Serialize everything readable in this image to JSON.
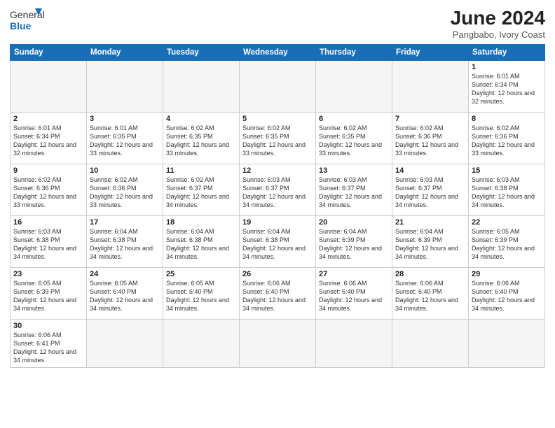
{
  "logo": {
    "text_general": "General",
    "text_blue": "Blue"
  },
  "header": {
    "month": "June 2024",
    "location": "Pangbabo, Ivory Coast"
  },
  "weekdays": [
    "Sunday",
    "Monday",
    "Tuesday",
    "Wednesday",
    "Thursday",
    "Friday",
    "Saturday"
  ],
  "weeks": [
    [
      {
        "day": "",
        "info": "",
        "empty": true
      },
      {
        "day": "",
        "info": "",
        "empty": true
      },
      {
        "day": "",
        "info": "",
        "empty": true
      },
      {
        "day": "",
        "info": "",
        "empty": true
      },
      {
        "day": "",
        "info": "",
        "empty": true
      },
      {
        "day": "",
        "info": "",
        "empty": true
      },
      {
        "day": "1",
        "info": "Sunrise: 6:01 AM\nSunset: 6:34 PM\nDaylight: 12 hours and 32 minutes.",
        "empty": false
      }
    ],
    [
      {
        "day": "2",
        "info": "Sunrise: 6:01 AM\nSunset: 6:34 PM\nDaylight: 12 hours and 32 minutes.",
        "empty": false
      },
      {
        "day": "3",
        "info": "Sunrise: 6:01 AM\nSunset: 6:35 PM\nDaylight: 12 hours and 33 minutes.",
        "empty": false
      },
      {
        "day": "4",
        "info": "Sunrise: 6:02 AM\nSunset: 6:35 PM\nDaylight: 12 hours and 33 minutes.",
        "empty": false
      },
      {
        "day": "5",
        "info": "Sunrise: 6:02 AM\nSunset: 6:35 PM\nDaylight: 12 hours and 33 minutes.",
        "empty": false
      },
      {
        "day": "6",
        "info": "Sunrise: 6:02 AM\nSunset: 6:35 PM\nDaylight: 12 hours and 33 minutes.",
        "empty": false
      },
      {
        "day": "7",
        "info": "Sunrise: 6:02 AM\nSunset: 6:36 PM\nDaylight: 12 hours and 33 minutes.",
        "empty": false
      },
      {
        "day": "8",
        "info": "Sunrise: 6:02 AM\nSunset: 6:36 PM\nDaylight: 12 hours and 33 minutes.",
        "empty": false
      }
    ],
    [
      {
        "day": "9",
        "info": "Sunrise: 6:02 AM\nSunset: 6:36 PM\nDaylight: 12 hours and 33 minutes.",
        "empty": false
      },
      {
        "day": "10",
        "info": "Sunrise: 6:02 AM\nSunset: 6:36 PM\nDaylight: 12 hours and 33 minutes.",
        "empty": false
      },
      {
        "day": "11",
        "info": "Sunrise: 6:02 AM\nSunset: 6:37 PM\nDaylight: 12 hours and 34 minutes.",
        "empty": false
      },
      {
        "day": "12",
        "info": "Sunrise: 6:03 AM\nSunset: 6:37 PM\nDaylight: 12 hours and 34 minutes.",
        "empty": false
      },
      {
        "day": "13",
        "info": "Sunrise: 6:03 AM\nSunset: 6:37 PM\nDaylight: 12 hours and 34 minutes.",
        "empty": false
      },
      {
        "day": "14",
        "info": "Sunrise: 6:03 AM\nSunset: 6:37 PM\nDaylight: 12 hours and 34 minutes.",
        "empty": false
      },
      {
        "day": "15",
        "info": "Sunrise: 6:03 AM\nSunset: 6:38 PM\nDaylight: 12 hours and 34 minutes.",
        "empty": false
      }
    ],
    [
      {
        "day": "16",
        "info": "Sunrise: 6:03 AM\nSunset: 6:38 PM\nDaylight: 12 hours and 34 minutes.",
        "empty": false
      },
      {
        "day": "17",
        "info": "Sunrise: 6:04 AM\nSunset: 6:38 PM\nDaylight: 12 hours and 34 minutes.",
        "empty": false
      },
      {
        "day": "18",
        "info": "Sunrise: 6:04 AM\nSunset: 6:38 PM\nDaylight: 12 hours and 34 minutes.",
        "empty": false
      },
      {
        "day": "19",
        "info": "Sunrise: 6:04 AM\nSunset: 6:38 PM\nDaylight: 12 hours and 34 minutes.",
        "empty": false
      },
      {
        "day": "20",
        "info": "Sunrise: 6:04 AM\nSunset: 6:39 PM\nDaylight: 12 hours and 34 minutes.",
        "empty": false
      },
      {
        "day": "21",
        "info": "Sunrise: 6:04 AM\nSunset: 6:39 PM\nDaylight: 12 hours and 34 minutes.",
        "empty": false
      },
      {
        "day": "22",
        "info": "Sunrise: 6:05 AM\nSunset: 6:39 PM\nDaylight: 12 hours and 34 minutes.",
        "empty": false
      }
    ],
    [
      {
        "day": "23",
        "info": "Sunrise: 6:05 AM\nSunset: 6:39 PM\nDaylight: 12 hours and 34 minutes.",
        "empty": false
      },
      {
        "day": "24",
        "info": "Sunrise: 6:05 AM\nSunset: 6:40 PM\nDaylight: 12 hours and 34 minutes.",
        "empty": false
      },
      {
        "day": "25",
        "info": "Sunrise: 6:05 AM\nSunset: 6:40 PM\nDaylight: 12 hours and 34 minutes.",
        "empty": false
      },
      {
        "day": "26",
        "info": "Sunrise: 6:06 AM\nSunset: 6:40 PM\nDaylight: 12 hours and 34 minutes.",
        "empty": false
      },
      {
        "day": "27",
        "info": "Sunrise: 6:06 AM\nSunset: 6:40 PM\nDaylight: 12 hours and 34 minutes.",
        "empty": false
      },
      {
        "day": "28",
        "info": "Sunrise: 6:06 AM\nSunset: 6:40 PM\nDaylight: 12 hours and 34 minutes.",
        "empty": false
      },
      {
        "day": "29",
        "info": "Sunrise: 6:06 AM\nSunset: 6:40 PM\nDaylight: 12 hours and 34 minutes.",
        "empty": false
      }
    ],
    [
      {
        "day": "30",
        "info": "Sunrise: 6:06 AM\nSunset: 6:41 PM\nDaylight: 12 hours and 34 minutes.",
        "empty": false
      },
      {
        "day": "",
        "info": "",
        "empty": true
      },
      {
        "day": "",
        "info": "",
        "empty": true
      },
      {
        "day": "",
        "info": "",
        "empty": true
      },
      {
        "day": "",
        "info": "",
        "empty": true
      },
      {
        "day": "",
        "info": "",
        "empty": true
      },
      {
        "day": "",
        "info": "",
        "empty": true
      }
    ]
  ]
}
